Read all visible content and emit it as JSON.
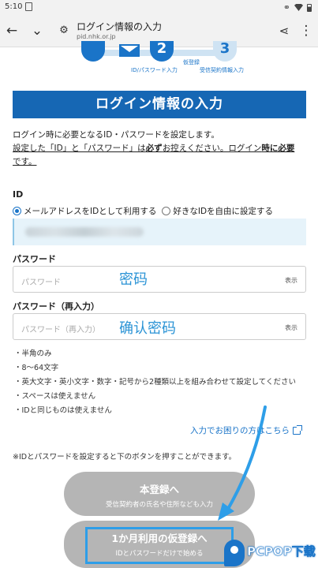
{
  "status_bar": {
    "time": "5:10",
    "link_icon": "link-icon",
    "wifi_icon": "wifi-icon",
    "battery_icon": "battery-icon"
  },
  "browser": {
    "title": "ログイン情報の入力",
    "url": "pid.nhk.or.jp",
    "back_icon": "back-arrow-icon",
    "tabs_icon": "chevron-down-icon",
    "settings_icon": "site-settings-icon",
    "share_icon": "share-icon",
    "menu_icon": "more-vert-icon"
  },
  "steps": {
    "step2_number": "2",
    "step3_number": "3",
    "step2_label": "ID/パスワード入力",
    "step3_label_top": "仮登録",
    "step3_label": "受信契約情報入力"
  },
  "heading": "ログイン情報の入力",
  "intro": {
    "line1": "ログイン時に必要となるID・パスワードを設定します。",
    "line2a": "設定した「ID」と「パスワード」は",
    "line2b": "必ず",
    "line2c": "お控えください。ログイン",
    "line2d": "時に必要",
    "line3": "です。"
  },
  "id_section": {
    "label": "ID",
    "option_email": "メールアドレスをIDとして利用する",
    "option_custom": "好きなIDを自由に設定する",
    "selected": "option_email"
  },
  "password": {
    "label": "パスワード",
    "placeholder": "パスワード",
    "show_label": "表示",
    "annotation": "密码"
  },
  "password_confirm": {
    "label": "パスワード（再入力）",
    "placeholder": "パスワード（再入力）",
    "show_label": "表示",
    "annotation": "确认密码"
  },
  "rules": [
    "・半角のみ",
    "・8〜64文字",
    "・英大文字・英小文字・数字・記号から2種類以上を組み合わせて設定してください",
    "・スペースは使えません",
    "・IDと同じものは使えません"
  ],
  "help_link": "入力でお困りの方はこちら",
  "note": "※IDとパスワードを設定すると下のボタンを押すことができます。",
  "buttons": {
    "main_title": "本登録へ",
    "main_sub": "受信契約者の氏名や住所なども入力",
    "temp_title": "1か月利用の仮登録へ",
    "temp_sub": "IDとパスワードだけで始める"
  },
  "colors": {
    "brand_blue": "#1667b4",
    "disabled_button": "#b5b5b5",
    "highlight": "#2e9ee8"
  },
  "watermark": {
    "text": "PCPOP下载"
  }
}
